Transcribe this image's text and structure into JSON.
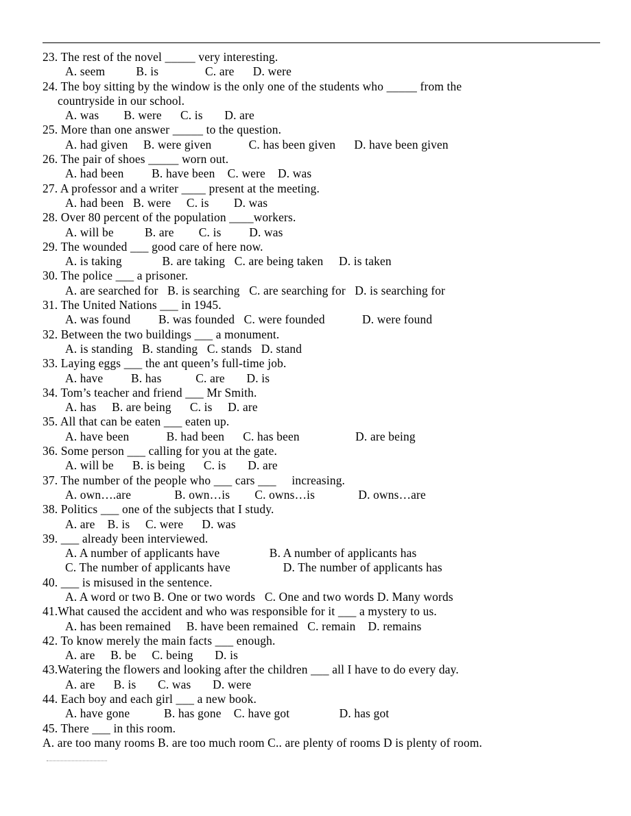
{
  "document": {
    "title": "Subject-Verb Agreement Multiple Choice Exercise",
    "has_top_rule": true,
    "has_footnote_rule": true,
    "text_color": "#000000",
    "background_color": "#ffffff"
  },
  "questions": [
    {
      "number": "23.",
      "stem": "23. The rest of the novel _____ very interesting.",
      "continuation": null,
      "option_lines": [
        "A. seem          B. is               C. are      D. were"
      ]
    },
    {
      "number": "24.",
      "stem": "24. The boy sitting by the window is the only one of the students who _____ from the",
      "continuation": "countryside in our school.",
      "option_lines": [
        "A. was        B. were      C. is       D. are"
      ]
    },
    {
      "number": "25.",
      "stem": "25. More than one answer _____ to the question.",
      "continuation": null,
      "option_lines": [
        "A. had given     B. were given            C. has been given      D. have been given"
      ]
    },
    {
      "number": "26.",
      "stem": "26. The pair of shoes _____ worn out.",
      "continuation": null,
      "option_lines": [
        "A. had been         B. have been    C. were    D. was"
      ]
    },
    {
      "number": "27.",
      "stem": "27. A professor and a writer ____ present at the meeting.",
      "continuation": null,
      "option_lines": [
        "A. had been   B. were     C. is        D. was"
      ]
    },
    {
      "number": "28.",
      "stem": "28. Over 80 percent of the population ____workers.",
      "continuation": null,
      "option_lines": [
        "A. will be          B. are        C. is         D. was"
      ]
    },
    {
      "number": "29.",
      "stem": "29. The wounded ___ good care of here now.",
      "continuation": null,
      "option_lines": [
        "A. is taking             B. are taking   C. are being taken     D. is taken"
      ]
    },
    {
      "number": "30.",
      "stem": "30. The police ___ a prisoner.",
      "continuation": null,
      "option_lines": [
        "A. are searched for   B. is searching   C. are searching for   D. is searching for"
      ]
    },
    {
      "number": "31.",
      "stem": "31. The United Nations ___ in 1945.",
      "continuation": null,
      "option_lines": [
        "A. was found         B. was founded   C. were founded            D. were found"
      ]
    },
    {
      "number": "32.",
      "stem": "32. Between the two buildings ___ a monument.",
      "continuation": null,
      "option_lines": [
        "A. is standing   B. standing   C. stands   D. stand"
      ]
    },
    {
      "number": "33.",
      "stem": "33. Laying eggs ___ the ant queen’s full-time job.",
      "continuation": null,
      "option_lines": [
        "A. have         B. has           C. are       D. is"
      ]
    },
    {
      "number": "34.",
      "stem": "34. Tom’s teacher and friend ___ Mr Smith.",
      "continuation": null,
      "option_lines": [
        "A. has     B. are being      C. is     D. are"
      ]
    },
    {
      "number": "35.",
      "stem": "35. All that can be eaten ___ eaten up.",
      "continuation": null,
      "option_lines": [
        "A. have been            B. had been      C. has been                  D. are being"
      ]
    },
    {
      "number": "36.",
      "stem": "36. Some person ___ calling for you at the gate.",
      "continuation": null,
      "option_lines": [
        "A. will be      B. is being      C. is       D. are"
      ]
    },
    {
      "number": "37.",
      "stem": "37. The number of the people who ___ cars ___     increasing.",
      "continuation": null,
      "option_lines": [
        "A. own….are              B. own…is        C. owns…is              D. owns…are"
      ]
    },
    {
      "number": "38.",
      "stem": "38. Politics ___ one of the subjects that I study.",
      "continuation": null,
      "option_lines": [
        "A. are    B. is     C. were      D. was"
      ]
    },
    {
      "number": "39.",
      "stem": "39. ___ already been interviewed.",
      "continuation": null,
      "option_lines": [
        "A. A number of applicants have                B. A number of applicants has",
        "C. The number of applicants have                 D. The number of applicants has"
      ]
    },
    {
      "number": "40.",
      "stem": "40. ___ is misused in the sentence.",
      "continuation": null,
      "option_lines": [
        "A. A word or two B. One or two words   C. One and two words D. Many words"
      ]
    },
    {
      "number": "41.",
      "stem": "41.What caused the accident and who was responsible for it ___ a mystery to us.",
      "continuation": null,
      "option_lines": [
        "A. has been remained     B. have been remained   C. remain    D. remains"
      ]
    },
    {
      "number": "42.",
      "stem": "42. To know merely the main facts ___ enough.",
      "continuation": null,
      "option_lines": [
        "A. are     B. be     C. being       D. is"
      ]
    },
    {
      "number": "43.",
      "stem": "43.Watering the flowers and looking after the children ___ all I have to do every day.",
      "continuation": null,
      "option_lines": [
        "A. are      B. is       C. was       D. were"
      ]
    },
    {
      "number": "44.",
      "stem": "44. Each boy and each girl ___ a new book.",
      "continuation": null,
      "option_lines": [
        "A. have gone           B. has gone    C. have got                D. has got"
      ]
    },
    {
      "number": "45.",
      "stem": "45. There ___ in this room.",
      "continuation": null,
      "option_lines": [],
      "flush_option_line": "A. are too many rooms B. are too much room C.. are plenty of rooms D is plenty of room."
    }
  ]
}
